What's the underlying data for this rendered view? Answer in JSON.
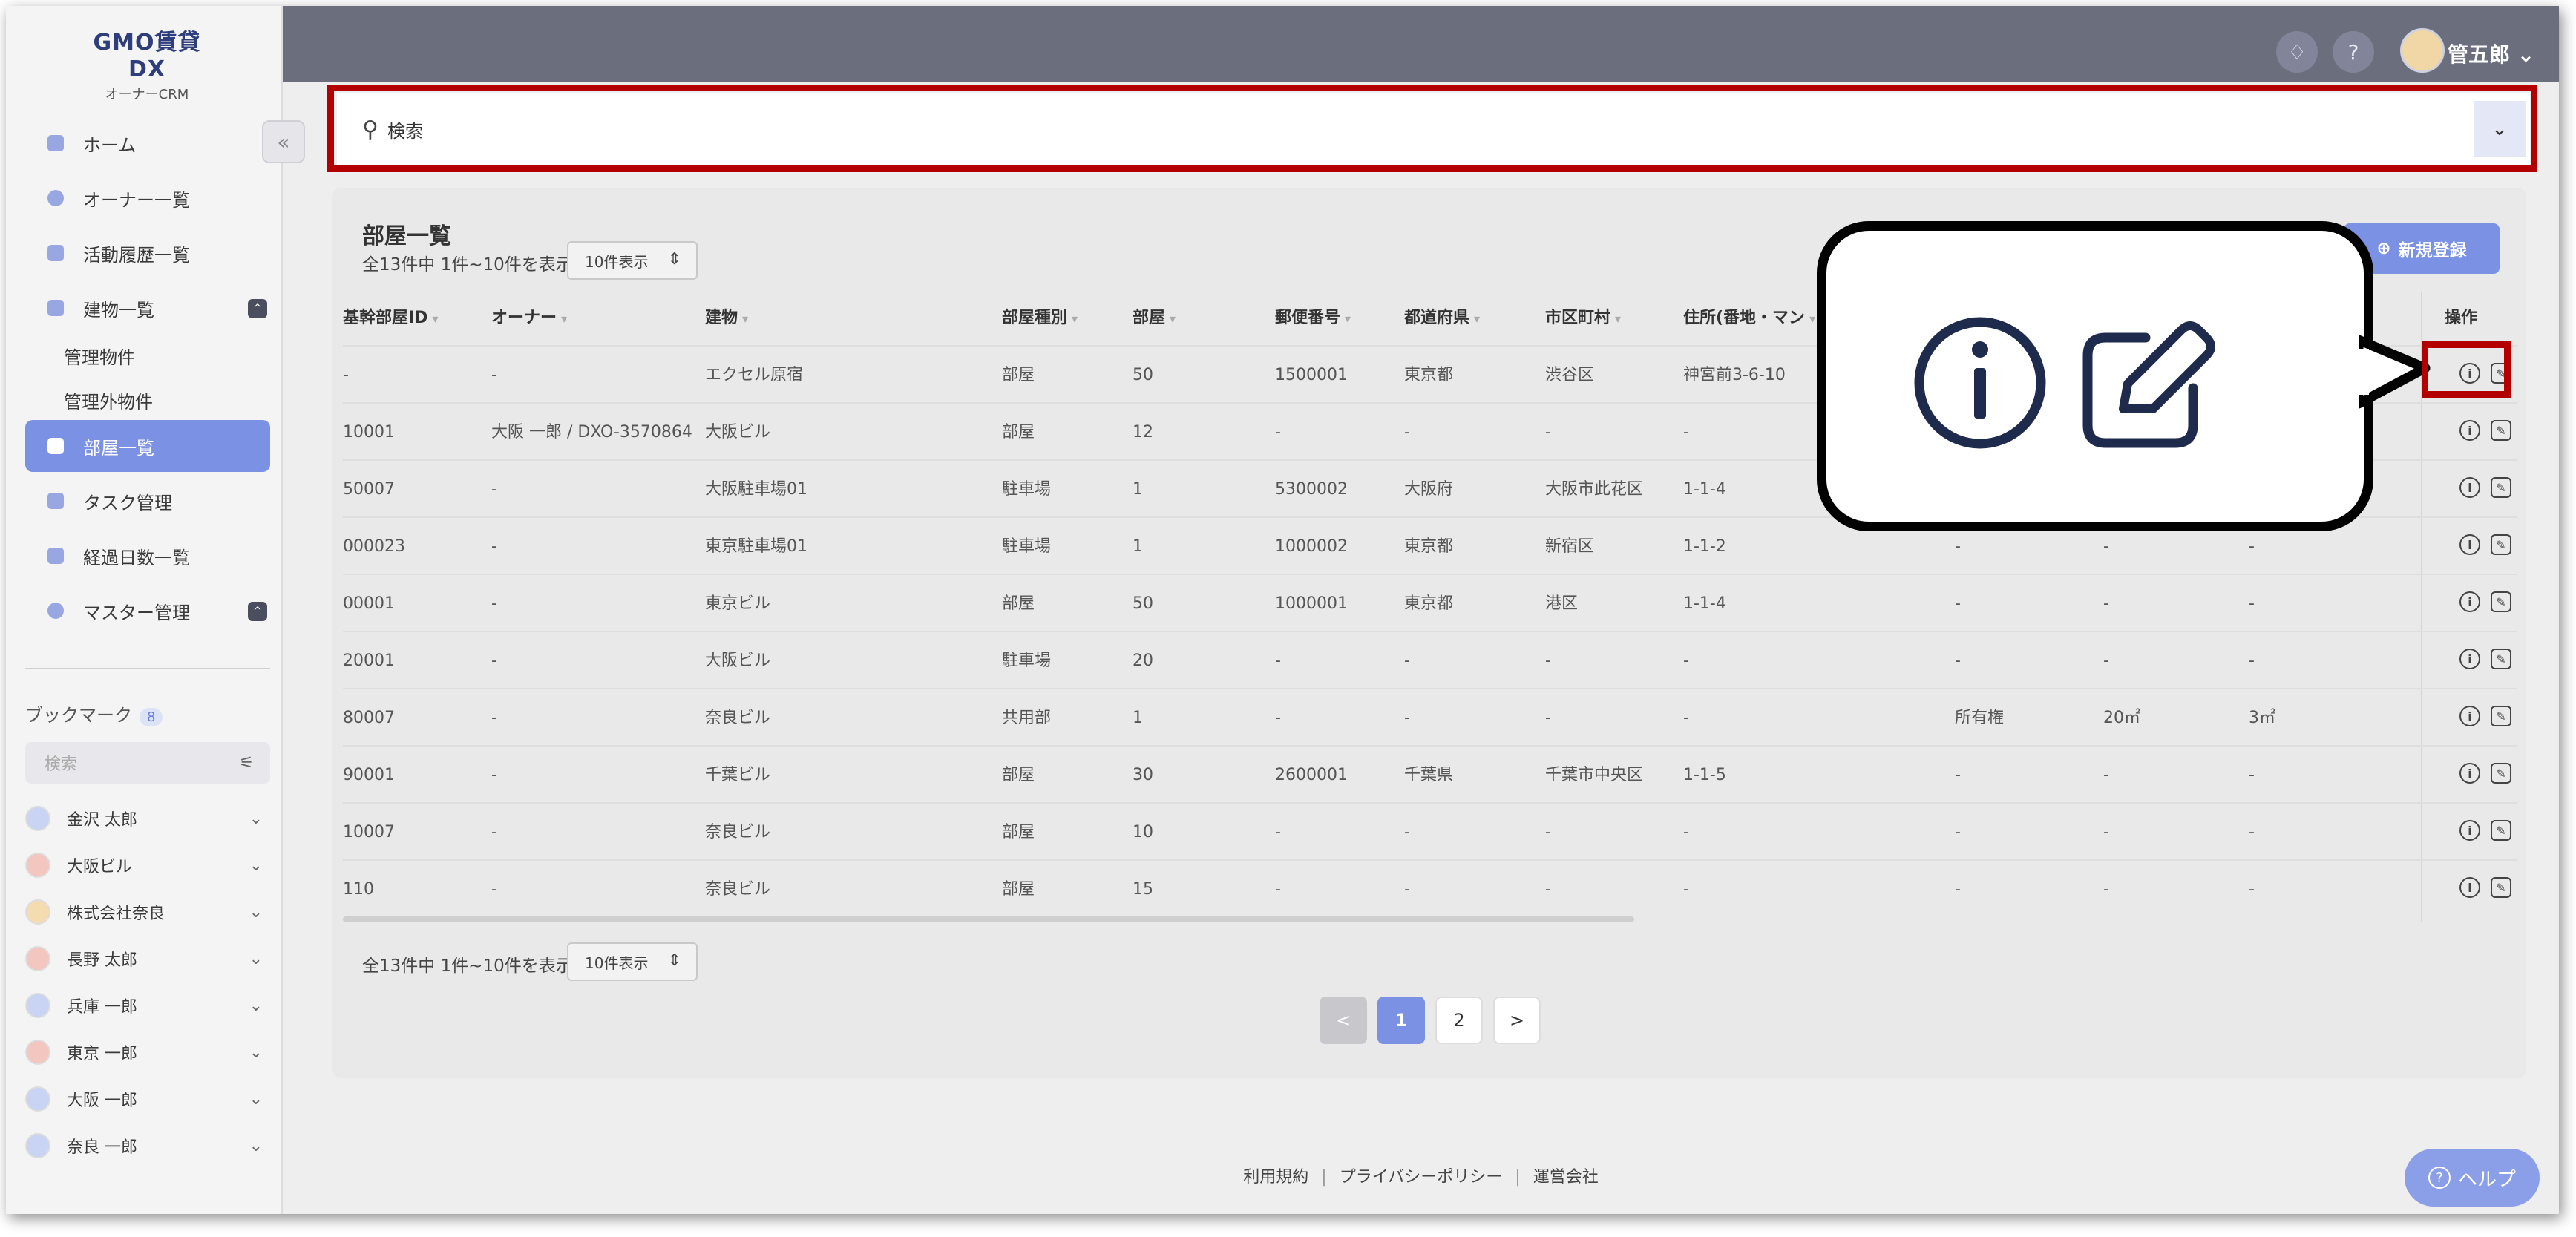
{
  "app": {
    "logo_main": "GMO賃貸DX",
    "logo_sub": "オーナーCRM"
  },
  "header": {
    "user_name": "管五郎",
    "user_chevron": "⌄",
    "bell_icon": "bell-icon",
    "help_icon": "question-icon"
  },
  "sidebar": {
    "collapse_glyph": "«",
    "items": [
      {
        "label": "ホーム",
        "icon": "home-icon"
      },
      {
        "label": "オーナー一覧",
        "icon": "owner-icon"
      },
      {
        "label": "活動履歴一覧",
        "icon": "history-icon"
      },
      {
        "label": "建物一覧",
        "icon": "building-icon",
        "expanded": true
      },
      {
        "label": "部屋一覧",
        "icon": "room-icon",
        "active": true
      },
      {
        "label": "タスク管理",
        "icon": "task-icon"
      },
      {
        "label": "経過日数一覧",
        "icon": "days-icon"
      },
      {
        "label": "マスター管理",
        "icon": "master-icon",
        "expanded": true
      }
    ],
    "subitems": [
      "管理物件",
      "管理外物件"
    ],
    "toggle_glyph": "^",
    "bookmark_title": "ブックマーク",
    "bookmark_count": "8",
    "bookmark_search_placeholder": "検索",
    "filter_glyph": "⚟",
    "bookmarks": [
      {
        "label": "金沢 太郎",
        "color": "#c9d3f3"
      },
      {
        "label": "大阪ビル",
        "color": "#f3c6c0"
      },
      {
        "label": "株式会社奈良",
        "color": "#f5dcb0"
      },
      {
        "label": "長野 太郎",
        "color": "#f3c6c0"
      },
      {
        "label": "兵庫 一郎",
        "color": "#c9d3f3"
      },
      {
        "label": "東京 一郎",
        "color": "#f3c6c0"
      },
      {
        "label": "大阪 一郎",
        "color": "#c9d3f3"
      },
      {
        "label": "奈良 一郎",
        "color": "#c9d3f3"
      }
    ],
    "bookmark_chevron": "⌄"
  },
  "search": {
    "label": "検索",
    "icon": "search-icon",
    "dropdown_glyph": "⌄"
  },
  "panel": {
    "title": "部屋一覧",
    "count_text": "全13件中 1件~10件を表示",
    "per_page": "10件表示",
    "per_page_glyph": "⇕",
    "new_button": "新規登録",
    "new_button_icon": "⊕",
    "columns": [
      "基幹部屋ID",
      "オーナー",
      "建物",
      "部屋種別",
      "部屋",
      "郵便番号",
      "都道府県",
      "市区町村",
      "住所(番地・マン",
      "操作"
    ],
    "sort_glyph": "▾",
    "rows": [
      {
        "id": "-",
        "owner": "-",
        "building": "エクセル原宿",
        "type": "部屋",
        "room": "50",
        "zip": "1500001",
        "pref": "東京都",
        "city": "渋谷区",
        "addr": "神宮前3-6-10",
        "c1": "",
        "c2": "",
        "c3": ""
      },
      {
        "id": "10001",
        "owner": "大阪 一郎 / DXO-3570864",
        "building": "大阪ビル",
        "type": "部屋",
        "room": "12",
        "zip": "-",
        "pref": "-",
        "city": "-",
        "addr": "-",
        "c1": "",
        "c2": "",
        "c3": ""
      },
      {
        "id": "50007",
        "owner": "-",
        "building": "大阪駐車場01",
        "type": "駐車場",
        "room": "1",
        "zip": "5300002",
        "pref": "大阪府",
        "city": "大阪市此花区",
        "addr": "1-1-4",
        "c1": "",
        "c2": "",
        "c3": ""
      },
      {
        "id": "000023",
        "owner": "-",
        "building": "東京駐車場01",
        "type": "駐車場",
        "room": "1",
        "zip": "1000002",
        "pref": "東京都",
        "city": "新宿区",
        "addr": "1-1-2",
        "c1": "-",
        "c2": "-",
        "c3": "-"
      },
      {
        "id": "00001",
        "owner": "-",
        "building": "東京ビル",
        "type": "部屋",
        "room": "50",
        "zip": "1000001",
        "pref": "東京都",
        "city": "港区",
        "addr": "1-1-4",
        "c1": "-",
        "c2": "-",
        "c3": "-"
      },
      {
        "id": "20001",
        "owner": "-",
        "building": "大阪ビル",
        "type": "駐車場",
        "room": "20",
        "zip": "-",
        "pref": "-",
        "city": "-",
        "addr": "-",
        "c1": "-",
        "c2": "-",
        "c3": "-"
      },
      {
        "id": "80007",
        "owner": "-",
        "building": "奈良ビル",
        "type": "共用部",
        "room": "1",
        "zip": "-",
        "pref": "-",
        "city": "-",
        "addr": "-",
        "c1": "所有権",
        "c2": "20㎡",
        "c3": "3㎡"
      },
      {
        "id": "90001",
        "owner": "-",
        "building": "千葉ビル",
        "type": "部屋",
        "room": "30",
        "zip": "2600001",
        "pref": "千葉県",
        "city": "千葉市中央区",
        "addr": "1-1-5",
        "c1": "-",
        "c2": "-",
        "c3": "-"
      },
      {
        "id": "10007",
        "owner": "-",
        "building": "奈良ビル",
        "type": "部屋",
        "room": "10",
        "zip": "-",
        "pref": "-",
        "city": "-",
        "addr": "-",
        "c1": "-",
        "c2": "-",
        "c3": "-"
      },
      {
        "id": "110",
        "owner": "-",
        "building": "奈良ビル",
        "type": "部屋",
        "room": "15",
        "zip": "-",
        "pref": "-",
        "city": "-",
        "addr": "-",
        "c1": "-",
        "c2": "-",
        "c3": "-"
      }
    ],
    "info_glyph": "i",
    "edit_glyph": "✎",
    "pagination": {
      "prev": "<",
      "pages": [
        "1",
        "2"
      ],
      "current": "1",
      "next": ">"
    }
  },
  "footer": {
    "links": [
      "利用規約",
      "プライバシーポリシー",
      "運営会社"
    ],
    "separator": "|"
  },
  "help_button": {
    "label": "ヘルプ",
    "icon": "?"
  },
  "colors": {
    "accent": "#7b91e3",
    "header": "#6b6e7d",
    "highlight_red": "#b30000"
  }
}
